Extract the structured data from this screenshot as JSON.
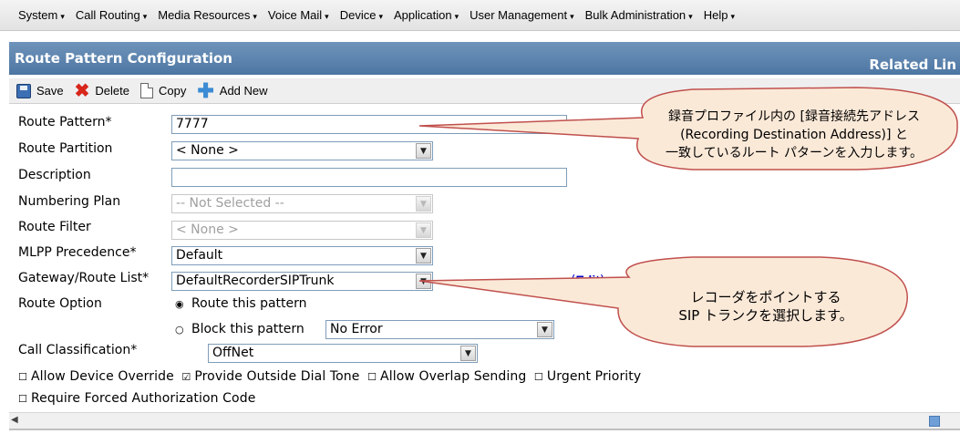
{
  "menu": {
    "items": [
      {
        "label": "System"
      },
      {
        "label": "Call Routing"
      },
      {
        "label": "Media Resources"
      },
      {
        "label": "Voice Mail"
      },
      {
        "label": "Device"
      },
      {
        "label": "Application"
      },
      {
        "label": "User Management"
      },
      {
        "label": "Bulk Administration"
      },
      {
        "label": "Help"
      }
    ],
    "arrow": "▾"
  },
  "titlebar": {
    "title": "Route Pattern Configuration",
    "related": "Related Lin"
  },
  "toolbar": {
    "save_label": "Save",
    "delete_label": "Delete",
    "copy_label": "Copy",
    "add_new_label": "Add New"
  },
  "form": {
    "route_pattern": {
      "label": "Route Pattern*",
      "value": "7777"
    },
    "route_partition": {
      "label": "Route Partition",
      "value": "< None >"
    },
    "description": {
      "label": "Description",
      "value": ""
    },
    "numbering_plan": {
      "label": "Numbering Plan",
      "value": "-- Not Selected --"
    },
    "route_filter": {
      "label": "Route Filter",
      "value": "< None >"
    },
    "mlpp_precedence": {
      "label": "MLPP Precedence*",
      "value": "Default"
    },
    "gateway_route_list": {
      "label": "Gateway/Route List*",
      "value": "DefaultRecorderSIPTrunk",
      "edit_open": "(",
      "edit_label": "Edit",
      "edit_close": ")"
    },
    "route_option": {
      "label": "Route Option",
      "option_route": "Route this pattern",
      "option_block": "Block this pattern",
      "block_reason": "No Error"
    },
    "call_classification": {
      "label": "Call Classification*",
      "value": "OffNet"
    },
    "checkboxes": {
      "allow_device_override": {
        "label": "Allow Device Override",
        "checked": false
      },
      "provide_outside_dial_tone": {
        "label": "Provide Outside Dial Tone",
        "checked": true
      },
      "allow_overlap_sending": {
        "label": "Allow Overlap Sending",
        "checked": false
      },
      "urgent_priority": {
        "label": "Urgent Priority",
        "checked": false
      },
      "require_forced_auth": {
        "label": "Require Forced Authorization Code",
        "checked": false
      }
    }
  },
  "callouts": {
    "top": {
      "line1": "録音プロファイル内の [録音接続先アドレス",
      "line2": "(Recording Destination Address)] と",
      "line3": "一致しているルート パターンを入力します。"
    },
    "bottom": {
      "line1": "レコーダをポイントする",
      "line2": "SIP トランクを選択します。"
    }
  },
  "colors": {
    "title_bar": "#5a82ad",
    "callout_fill": "#fbe9d8",
    "callout_stroke": "#c0504d",
    "link": "#0000cc"
  }
}
